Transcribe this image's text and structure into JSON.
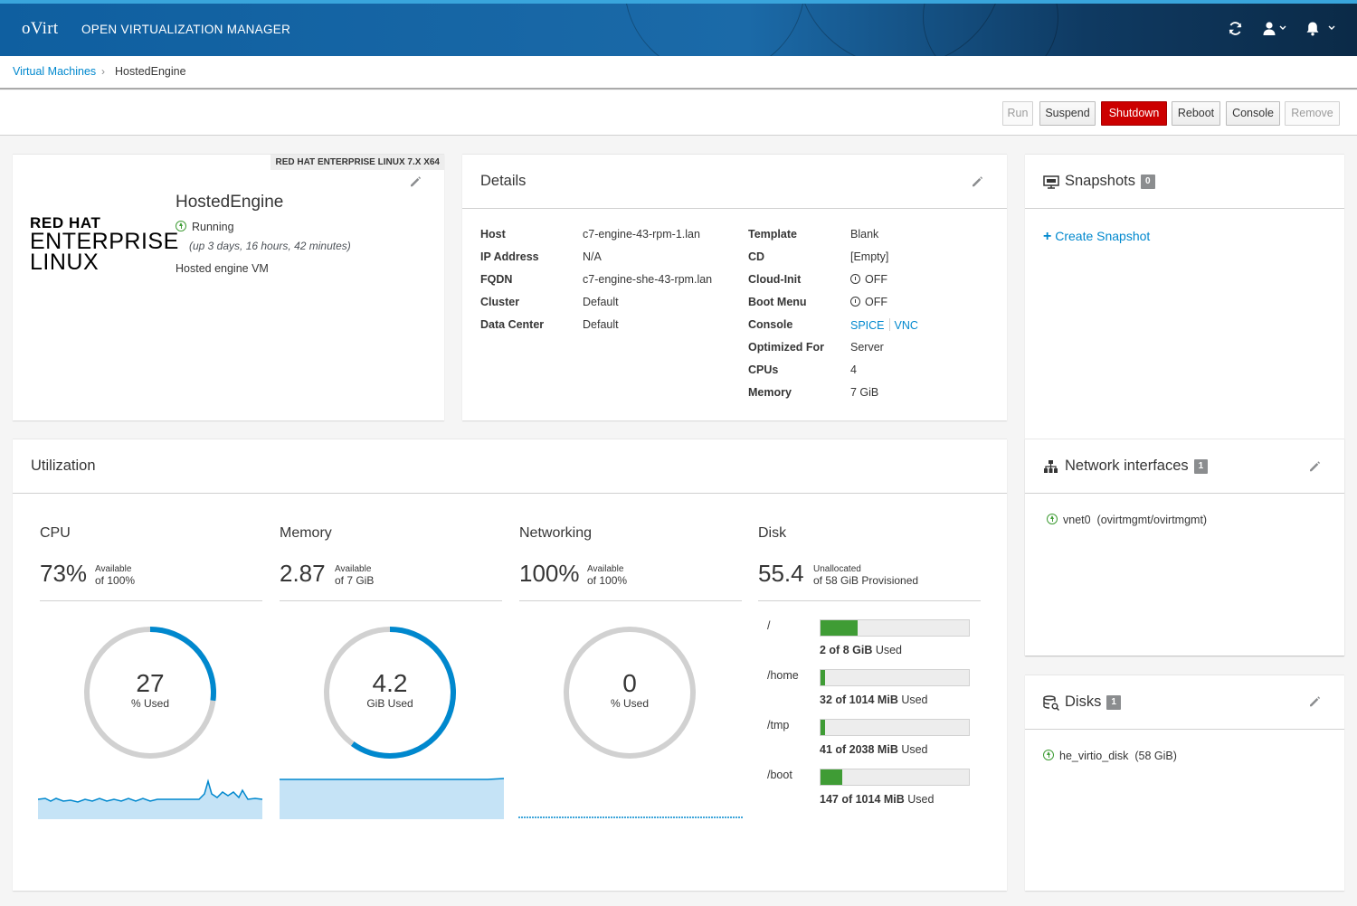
{
  "header": {
    "logo": "oVirt",
    "title": "OPEN VIRTUALIZATION MANAGER"
  },
  "breadcrumb": {
    "parent": "Virtual Machines",
    "separator": "›",
    "current": "HostedEngine"
  },
  "toolbar": {
    "run": "Run",
    "suspend": "Suspend",
    "shutdown": "Shutdown",
    "reboot": "Reboot",
    "console": "Console",
    "remove": "Remove"
  },
  "vm": {
    "os_tag": "RED HAT ENTERPRISE LINUX 7.X X64",
    "logo": {
      "line1": "RED HAT",
      "line2": "ENTERPRISE",
      "line3": "LINUX"
    },
    "name": "HostedEngine",
    "status": "Running",
    "uptime": "(up 3 days, 16 hours, 42 minutes)",
    "description": "Hosted engine VM"
  },
  "details": {
    "title": "Details",
    "left": [
      {
        "key": "Host",
        "value": "c7-engine-43-rpm-1.lan"
      },
      {
        "key": "IP Address",
        "value": "N/A"
      },
      {
        "key": "FQDN",
        "value": "c7-engine-she-43-rpm.lan"
      },
      {
        "key": "Cluster",
        "value": "Default"
      },
      {
        "key": "Data Center",
        "value": "Default"
      }
    ],
    "right": [
      {
        "key": "Template",
        "value": "Blank"
      },
      {
        "key": "CD",
        "value": "[Empty]"
      },
      {
        "key": "Cloud-Init",
        "value": "OFF"
      },
      {
        "key": "Boot Menu",
        "value": "OFF"
      },
      {
        "key": "Console",
        "value": ""
      },
      {
        "key": "Optimized For",
        "value": "Server"
      },
      {
        "key": "CPUs",
        "value": "4"
      },
      {
        "key": "Memory",
        "value": "7 GiB"
      }
    ],
    "console_links": [
      "SPICE",
      "VNC"
    ]
  },
  "snapshots": {
    "title": "Snapshots",
    "count": "0",
    "create_label": "Create Snapshot"
  },
  "network": {
    "title": "Network interfaces",
    "count": "1",
    "item_name": "vnet0",
    "item_detail": "(ovirtmgmt/ovirtmgmt)"
  },
  "disks": {
    "title": "Disks",
    "count": "1",
    "item_name": "he_virtio_disk",
    "item_detail": "(58 GiB)"
  },
  "utilization": {
    "title": "Utilization",
    "cpu": {
      "title": "CPU",
      "available": "73%",
      "avail_label": "Available",
      "of": "of 100%",
      "used": "27",
      "used_label": "% Used",
      "used_fraction": 0.27
    },
    "memory": {
      "title": "Memory",
      "available": "2.87",
      "avail_label": "Available",
      "of": "of 7 GiB",
      "used": "4.2",
      "used_label": "GiB Used",
      "used_fraction": 0.6
    },
    "networking": {
      "title": "Networking",
      "available": "100%",
      "avail_label": "Available",
      "of": "of 100%",
      "used": "0",
      "used_label": "% Used",
      "used_fraction": 0
    },
    "disk": {
      "title": "Disk",
      "unallocated": "55.4",
      "unalloc_label": "Unallocated",
      "of": "of 58 GiB Provisioned",
      "partitions": [
        {
          "name": "/",
          "used": "2 of 8 GiB",
          "suffix": "Used",
          "fraction": 0.25
        },
        {
          "name": "/home",
          "used": "32 of 1014 MiB",
          "suffix": "Used",
          "fraction": 0.032
        },
        {
          "name": "/tmp",
          "used": "41 of 2038 MiB",
          "suffix": "Used",
          "fraction": 0.02
        },
        {
          "name": "/boot",
          "used": "147 of 1014 MiB",
          "suffix": "Used",
          "fraction": 0.145
        }
      ]
    }
  },
  "colors": {
    "accent": "#0088ce",
    "danger": "#cc0000",
    "success": "#3f9c35",
    "donut_track": "#d1d1d1",
    "spark_fill": "#c5e3f6"
  }
}
